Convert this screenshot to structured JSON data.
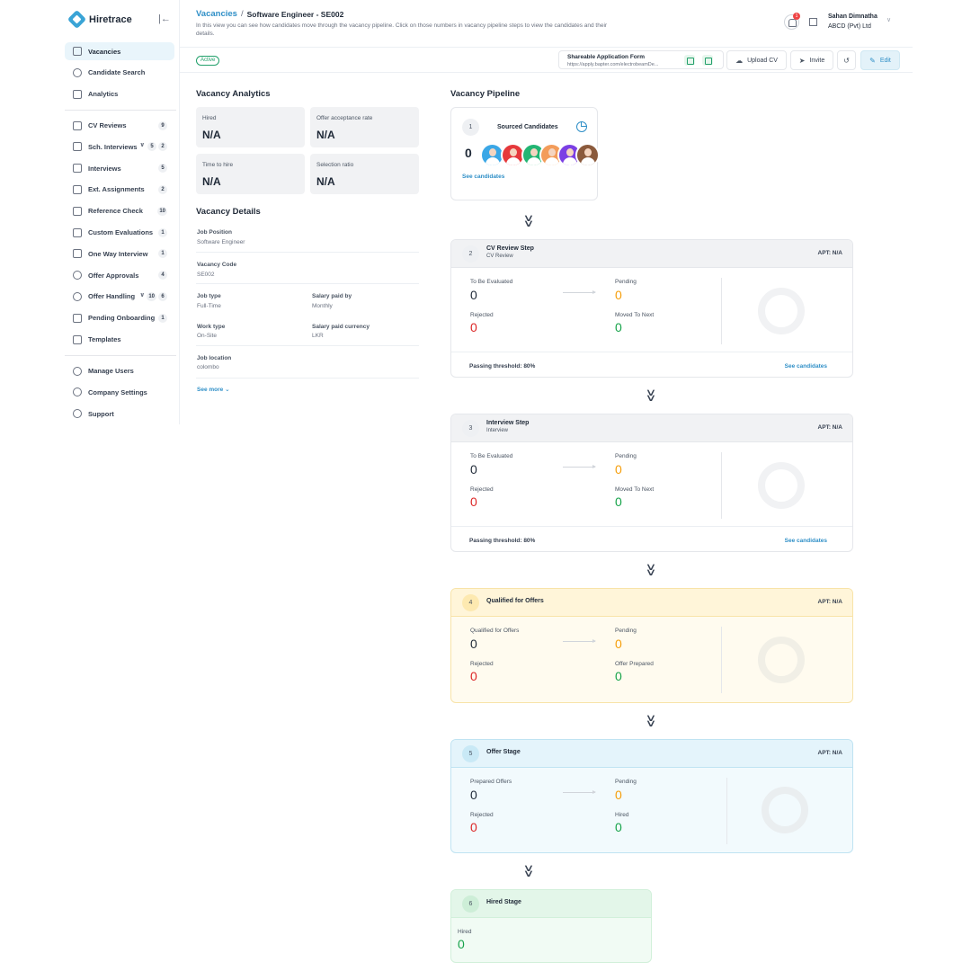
{
  "brand": {
    "name": "Hiretrace"
  },
  "sidebar": {
    "items": [
      {
        "label": "Vacancies",
        "active": true,
        "icon": "layers-icon"
      },
      {
        "label": "Candidate Search",
        "icon": "search-icon"
      },
      {
        "label": "Analytics",
        "icon": "chart-icon"
      },
      {
        "label": "CV Reviews",
        "badge": "9",
        "icon": "stack-icon"
      },
      {
        "label": "Sch. Interviews",
        "badge": "5",
        "badge2": "2",
        "icon": "calendar-icon"
      },
      {
        "label": "Interviews",
        "badge": "5",
        "icon": "video-icon"
      },
      {
        "label": "Ext. Assignments",
        "badge": "2",
        "icon": "book-icon"
      },
      {
        "label": "Reference Check",
        "badge": "10",
        "icon": "checklist-icon"
      },
      {
        "label": "Custom Evaluations",
        "badge": "1",
        "icon": "cube-icon"
      },
      {
        "label": "One Way Interview",
        "badge": "1",
        "icon": "monitor-icon"
      },
      {
        "label": "Offer Approvals",
        "badge": "4",
        "icon": "check-circle-icon"
      },
      {
        "label": "Offer Handling",
        "badge": "10",
        "badge2": "6",
        "icon": "refresh-icon"
      },
      {
        "label": "Pending Onboarding",
        "badge": "1",
        "icon": "forward-icon"
      },
      {
        "label": "Templates",
        "icon": "document-icon"
      },
      {
        "label": "Manage Users",
        "icon": "users-icon"
      },
      {
        "label": "Company Settings",
        "icon": "gear-icon"
      },
      {
        "label": "Support",
        "icon": "help-icon"
      }
    ]
  },
  "header": {
    "crumb_link": "Vacancies",
    "crumb_sep": "/",
    "crumb_current": "Software Engineer - SE002",
    "description": "In this view you can see how candidates move through the vacancy pipeline. Click on those numbers in vacancy pipeline steps to view the candidates and their details.",
    "notification_count": "1",
    "user_name": "Sahan Dimnatha",
    "user_org": "ABCD (Pvt) Ltd"
  },
  "toolbar": {
    "status": "Active",
    "share_title": "Shareable Application Form",
    "share_url": "https://apply.bapter.com/electrobeamDe...",
    "upload_label": "Upload CV",
    "invite_label": "Invite",
    "edit_label": "Edit"
  },
  "analytics": {
    "title": "Vacancy Analytics",
    "metrics": [
      {
        "label": "Hired",
        "value": "N/A"
      },
      {
        "label": "Offer acceptance rate",
        "value": "N/A"
      },
      {
        "label": "Time to hire",
        "value": "N/A"
      },
      {
        "label": "Selection ratio",
        "value": "N/A"
      }
    ]
  },
  "details": {
    "title": "Vacancy Details",
    "job_position": {
      "label": "Job Position",
      "value": "Software Engineer"
    },
    "vacancy_code": {
      "label": "Vacancy Code",
      "value": "SE002"
    },
    "job_type": {
      "label": "Job type",
      "value": "Full-Time"
    },
    "salary_paid_by": {
      "label": "Salary paid by",
      "value": "Monthly"
    },
    "work_type": {
      "label": "Work type",
      "value": "On-Site"
    },
    "salary_currency": {
      "label": "Salary paid currency",
      "value": "LKR"
    },
    "job_location": {
      "label": "Job location",
      "value": "colombo"
    },
    "see_more": "See more"
  },
  "pipeline": {
    "title": "Vacancy Pipeline",
    "sourced": {
      "num": "1",
      "title": "Sourced Candidates",
      "count": "0",
      "link": "See candidates",
      "avatar_colors": [
        "#3ba7e6",
        "#e5383b",
        "#22b573",
        "#f39c5a",
        "#7b3fe4",
        "#8b5a3c"
      ]
    },
    "cv_review": {
      "num": "2",
      "title": "CV Review Step",
      "sub": "CV Review",
      "apt": "APT: N/A",
      "a_label": "To Be Evaluated",
      "a_value": "0",
      "b_label": "Pending",
      "b_value": "0",
      "c_label": "Rejected",
      "c_value": "0",
      "d_label": "Moved To Next",
      "d_value": "0",
      "threshold": "Passing threshold: 80%",
      "link": "See candidates"
    },
    "interview": {
      "num": "3",
      "title": "Interview Step",
      "sub": "Interview",
      "apt": "APT: N/A",
      "a_label": "To Be Evaluated",
      "a_value": "0",
      "b_label": "Pending",
      "b_value": "0",
      "c_label": "Rejected",
      "c_value": "0",
      "d_label": "Moved To Next",
      "d_value": "0",
      "threshold": "Passing threshold: 80%",
      "link": "See candidates"
    },
    "qualified": {
      "num": "4",
      "title": "Qualified for Offers",
      "apt": "APT: N/A",
      "a_label": "Qualified for Offers",
      "a_value": "0",
      "b_label": "Pending",
      "b_value": "0",
      "c_label": "Rejected",
      "c_value": "0",
      "d_label": "Offer Prepared",
      "d_value": "0"
    },
    "offer": {
      "num": "5",
      "title": "Offer Stage",
      "apt": "APT: N/A",
      "a_label": "Prepared Offers",
      "a_value": "0",
      "b_label": "Pending",
      "b_value": "0",
      "c_label": "Rejected",
      "c_value": "0",
      "d_label": "Hired",
      "d_value": "0"
    },
    "hired": {
      "num": "6",
      "title": "Hired Stage",
      "label": "Hired",
      "value": "0"
    }
  }
}
